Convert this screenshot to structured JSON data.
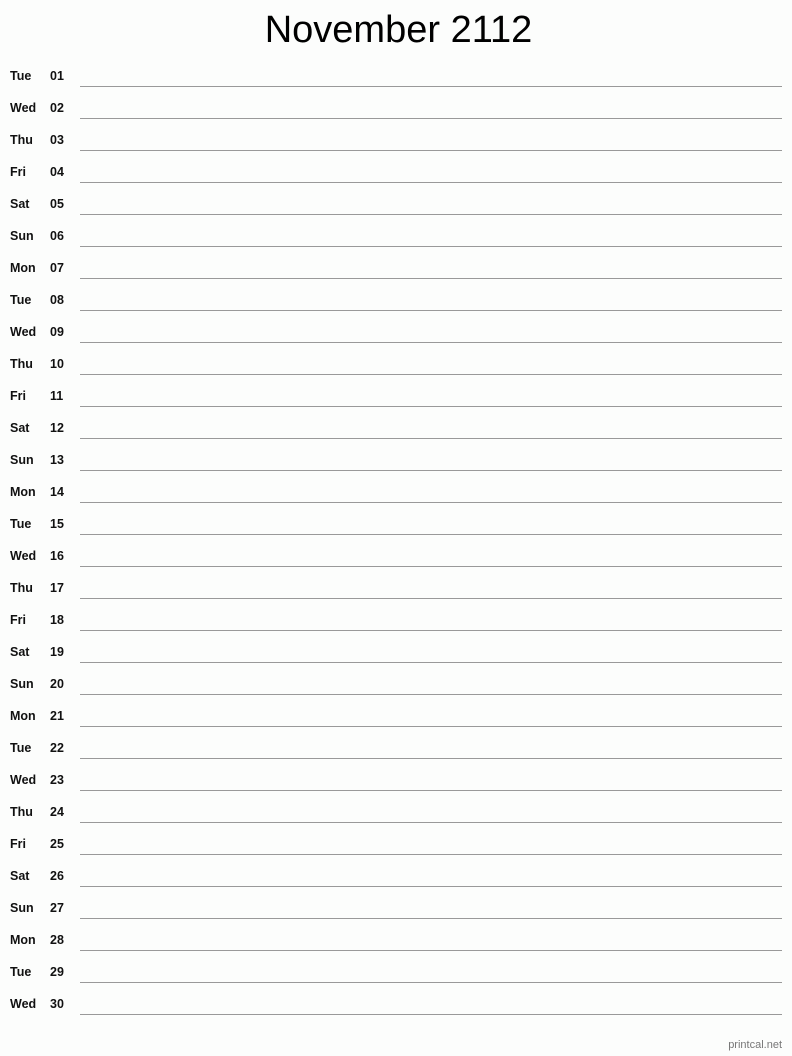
{
  "title": "November 2112",
  "days": [
    {
      "dow": "Tue",
      "day": "01"
    },
    {
      "dow": "Wed",
      "day": "02"
    },
    {
      "dow": "Thu",
      "day": "03"
    },
    {
      "dow": "Fri",
      "day": "04"
    },
    {
      "dow": "Sat",
      "day": "05"
    },
    {
      "dow": "Sun",
      "day": "06"
    },
    {
      "dow": "Mon",
      "day": "07"
    },
    {
      "dow": "Tue",
      "day": "08"
    },
    {
      "dow": "Wed",
      "day": "09"
    },
    {
      "dow": "Thu",
      "day": "10"
    },
    {
      "dow": "Fri",
      "day": "11"
    },
    {
      "dow": "Sat",
      "day": "12"
    },
    {
      "dow": "Sun",
      "day": "13"
    },
    {
      "dow": "Mon",
      "day": "14"
    },
    {
      "dow": "Tue",
      "day": "15"
    },
    {
      "dow": "Wed",
      "day": "16"
    },
    {
      "dow": "Thu",
      "day": "17"
    },
    {
      "dow": "Fri",
      "day": "18"
    },
    {
      "dow": "Sat",
      "day": "19"
    },
    {
      "dow": "Sun",
      "day": "20"
    },
    {
      "dow": "Mon",
      "day": "21"
    },
    {
      "dow": "Tue",
      "day": "22"
    },
    {
      "dow": "Wed",
      "day": "23"
    },
    {
      "dow": "Thu",
      "day": "24"
    },
    {
      "dow": "Fri",
      "day": "25"
    },
    {
      "dow": "Sat",
      "day": "26"
    },
    {
      "dow": "Sun",
      "day": "27"
    },
    {
      "dow": "Mon",
      "day": "28"
    },
    {
      "dow": "Tue",
      "day": "29"
    },
    {
      "dow": "Wed",
      "day": "30"
    }
  ],
  "footer": "printcal.net"
}
